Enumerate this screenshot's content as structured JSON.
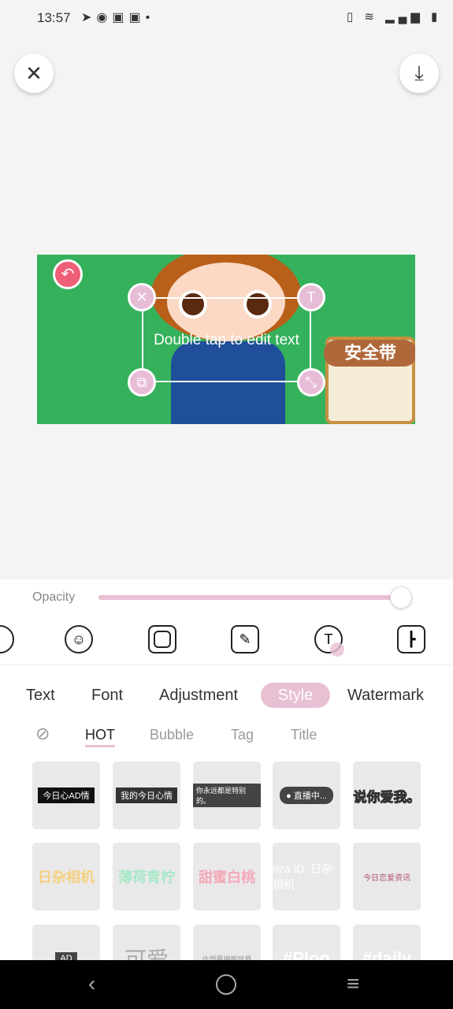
{
  "status": {
    "time": "13:57",
    "icons": [
      "telegram-icon",
      "app-icon",
      "mail-icon",
      "mail-icon",
      "dot-icon"
    ],
    "right_icons": [
      "vibrate-icon",
      "wifi-icon",
      "signal-icon",
      "battery-icon"
    ]
  },
  "canvas": {
    "overlay_text": "Double tap to edit text",
    "sign_text": "安全带"
  },
  "opacity": {
    "label": "Opacity",
    "value": 0.94,
    "accent": "#e8c0d4"
  },
  "tools": [
    "sticker-icon",
    "emoji-icon",
    "frame-icon",
    "edit-icon",
    "text-icon",
    "layout-icon"
  ],
  "tabs": [
    {
      "label": "Text"
    },
    {
      "label": "Font"
    },
    {
      "label": "Adjustment"
    },
    {
      "label": "Style",
      "active": true
    },
    {
      "label": "Watermark"
    }
  ],
  "subtabs": [
    {
      "label": "HOT",
      "active": true
    },
    {
      "label": "Bubble"
    },
    {
      "label": "Tag"
    },
    {
      "label": "Title"
    }
  ],
  "tiles": [
    [
      "今日心AD情",
      "我的今日心情",
      "你永远都是特别的。",
      "● 直播中...",
      "说你爱我。"
    ],
    [
      "日杂相机",
      "薄荷青柠",
      "甜蜜白桃",
      "riza ID: 日杂相机",
      "今日恋爱资讯"
    ],
    [
      "AD",
      "可爱",
      "也想要拥抱世界",
      "#Plog",
      "#daily"
    ]
  ]
}
